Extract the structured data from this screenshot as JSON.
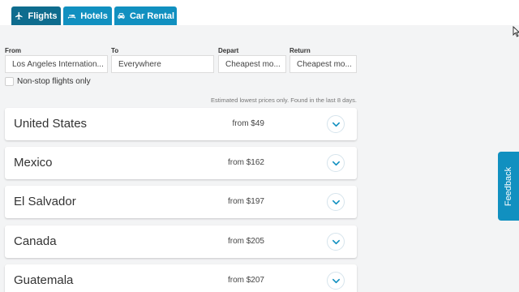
{
  "tabs": [
    {
      "label": "Flights",
      "icon": "plane-icon",
      "active": true
    },
    {
      "label": "Hotels",
      "icon": "bed-icon",
      "active": false
    },
    {
      "label": "Car Rental",
      "icon": "car-icon",
      "active": false
    }
  ],
  "search": {
    "from": {
      "label": "From",
      "value": "Los Angeles Internation..."
    },
    "to": {
      "label": "To",
      "value": "Everywhere"
    },
    "depart": {
      "label": "Depart",
      "value": "Cheapest mo..."
    },
    "return": {
      "label": "Return",
      "value": "Cheapest mo..."
    }
  },
  "nonstop": {
    "label": "Non-stop flights only",
    "checked": false
  },
  "note": "Estimated lowest prices only. Found in the last 8 days.",
  "results": [
    {
      "country": "United States",
      "price": "from $49"
    },
    {
      "country": "Mexico",
      "price": "from $162"
    },
    {
      "country": "El Salvador",
      "price": "from $197"
    },
    {
      "country": "Canada",
      "price": "from $205"
    },
    {
      "country": "Guatemala",
      "price": "from $207"
    }
  ],
  "feedback_label": "Feedback",
  "colors": {
    "accent": "#1190c0",
    "active_tab": "#0e6c8e",
    "background": "#f3f4f5"
  }
}
